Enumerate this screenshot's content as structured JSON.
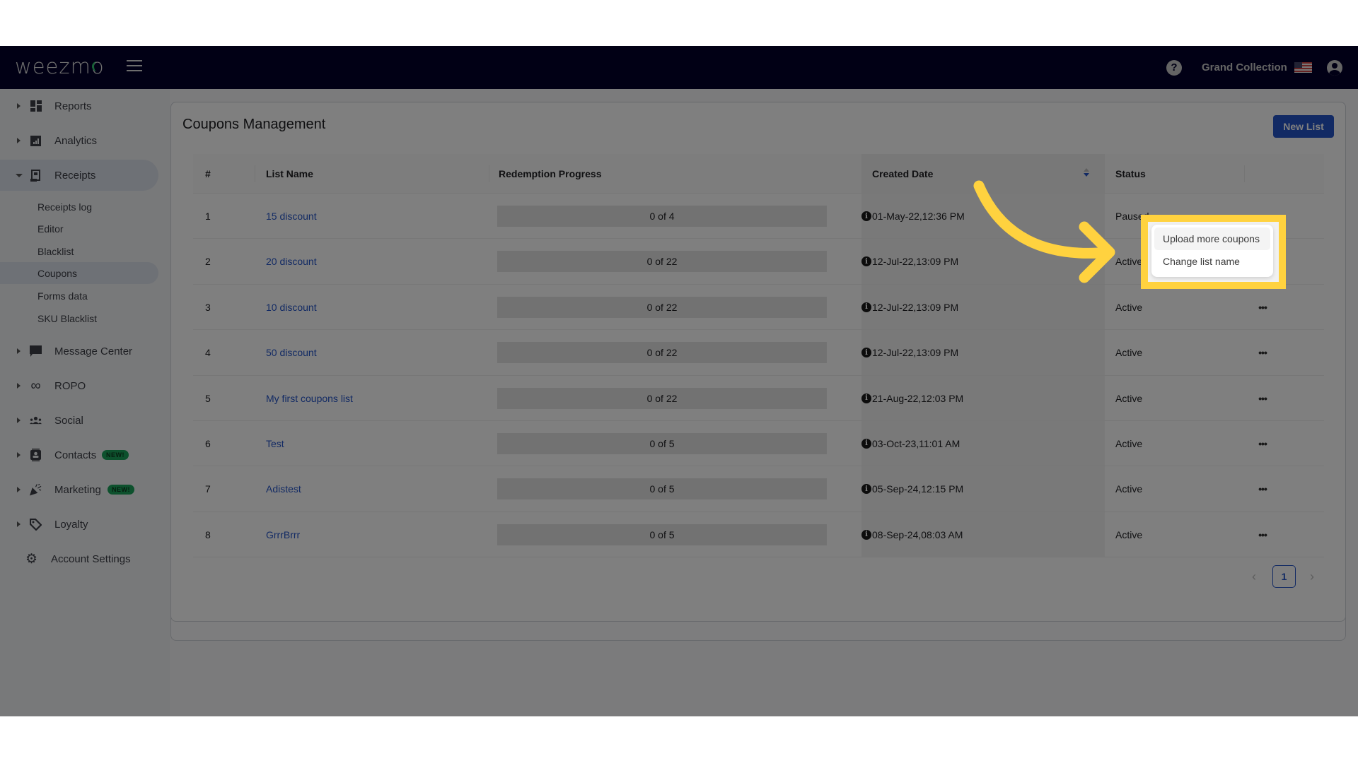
{
  "header": {
    "logo": "weezmo",
    "organization": "Grand Collection",
    "icons": [
      "hamburger-menu-icon",
      "help-icon",
      "us-flag-icon",
      "user-account-icon"
    ]
  },
  "sidebar": {
    "items": [
      {
        "label": "Reports",
        "icon": "dashboard-icon"
      },
      {
        "label": "Analytics",
        "icon": "analytics-icon"
      },
      {
        "label": "Receipts",
        "icon": "receipt-icon",
        "expanded": true,
        "children": [
          "Receipts log",
          "Editor",
          "Blacklist",
          "Coupons",
          "Forms data",
          "SKU Blacklist"
        ],
        "active_child": "Coupons"
      },
      {
        "label": "Message Center",
        "icon": "chat-icon"
      },
      {
        "label": "ROPO",
        "icon": "infinity-icon"
      },
      {
        "label": "Social",
        "icon": "people-icon"
      },
      {
        "label": "Contacts",
        "icon": "contacts-icon",
        "badge": "NEW!"
      },
      {
        "label": "Marketing",
        "icon": "party-popper-icon",
        "badge": "NEW!"
      },
      {
        "label": "Loyalty",
        "icon": "tag-icon"
      },
      {
        "label": "Account Settings",
        "icon": "gear-icon"
      }
    ]
  },
  "main": {
    "title": "Coupons Management",
    "new_list_label": "New List",
    "table": {
      "columns": [
        "#",
        "List Name",
        "Redemption Progress",
        "Created Date",
        "Status"
      ],
      "sorted_column": "Created Date",
      "rows": [
        {
          "num": "1",
          "name": "15 discount",
          "redeemed": 0,
          "total": 4,
          "progress": "0 of 4",
          "created": "01-May-22,12:36 PM",
          "status": "Paused"
        },
        {
          "num": "2",
          "name": "20 discount",
          "redeemed": 0,
          "total": 22,
          "progress": "0 of 22",
          "created": "12-Jul-22,13:09 PM",
          "status": "Active"
        },
        {
          "num": "3",
          "name": "10 discount",
          "redeemed": 0,
          "total": 22,
          "progress": "0 of 22",
          "created": "12-Jul-22,13:09 PM",
          "status": "Active"
        },
        {
          "num": "4",
          "name": "50 discount",
          "redeemed": 0,
          "total": 22,
          "progress": "0 of 22",
          "created": "12-Jul-22,13:09 PM",
          "status": "Active"
        },
        {
          "num": "5",
          "name": "My first coupons list",
          "redeemed": 0,
          "total": 22,
          "progress": "0 of 22",
          "created": "21-Aug-22,12:03 PM",
          "status": "Active"
        },
        {
          "num": "6",
          "name": "Test",
          "redeemed": 0,
          "total": 5,
          "progress": "0 of 5",
          "created": "03-Oct-23,11:01 AM",
          "status": "Active"
        },
        {
          "num": "7",
          "name": "Adistest",
          "redeemed": 0,
          "total": 5,
          "progress": "0 of 5",
          "created": "05-Sep-24,12:15 PM",
          "status": "Active"
        },
        {
          "num": "8",
          "name": "GrrrBrrr",
          "redeemed": 0,
          "total": 5,
          "progress": "0 of 5",
          "created": "08-Sep-24,08:03 AM",
          "status": "Active"
        }
      ]
    },
    "pagination": {
      "current_page": "1",
      "prev": "‹",
      "next": "›"
    }
  },
  "dropdown": {
    "items": [
      "Upload more coupons",
      "Change list name"
    ],
    "hovered": "Upload more coupons"
  },
  "annotation": {
    "highlight_color": "#ffd23f"
  },
  "colors": {
    "header_bg": "#03012a",
    "accent": "#2454c8",
    "badge_new": "#1aa35a"
  }
}
